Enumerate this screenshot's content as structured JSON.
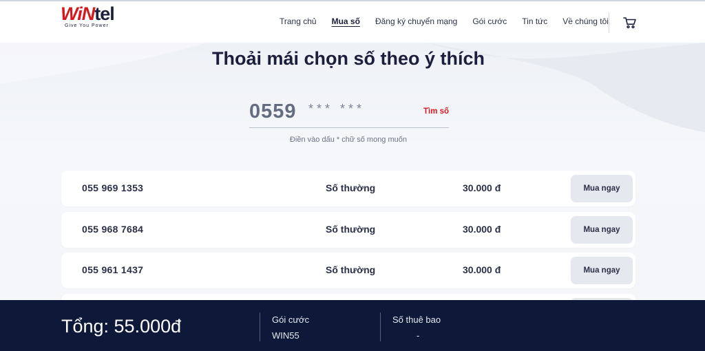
{
  "brand": {
    "name_part1": "WiN",
    "name_part2": "tel",
    "tagline": "Give You Power"
  },
  "nav": {
    "items": [
      {
        "label": "Trang chủ",
        "active": false
      },
      {
        "label": "Mua số",
        "active": true
      },
      {
        "label": "Đăng ký chuyển mạng",
        "active": false
      },
      {
        "label": "Gói cước",
        "active": false
      },
      {
        "label": "Tin tức",
        "active": false
      },
      {
        "label": "Về chúng tôi",
        "active": false
      }
    ],
    "cart_icon": "cart-icon"
  },
  "hero": {
    "title": "Thoải mái chọn số theo ý thích"
  },
  "search": {
    "prefix": "0559",
    "mask_value": "*** ***",
    "button_label": "Tìm số",
    "hint": "Điền vào dấu * chữ số mong muốn"
  },
  "results": [
    {
      "number": "055 969 1353",
      "type": "Số thường",
      "price": "30.000 đ",
      "action": "Mua ngay"
    },
    {
      "number": "055 968 7684",
      "type": "Số thường",
      "price": "30.000 đ",
      "action": "Mua ngay"
    },
    {
      "number": "055 961 1437",
      "type": "Số thường",
      "price": "30.000 đ",
      "action": "Mua ngay"
    }
  ],
  "footer": {
    "total": "Tổng: 55.000đ",
    "plan_label": "Gói cước",
    "plan_value": "WIN55",
    "subscriber_label": "Số thuê bao",
    "subscriber_value": "-"
  },
  "colors": {
    "brand_red": "#d7191f",
    "navy": "#0e1838",
    "button_grey": "#e5e8ef"
  }
}
